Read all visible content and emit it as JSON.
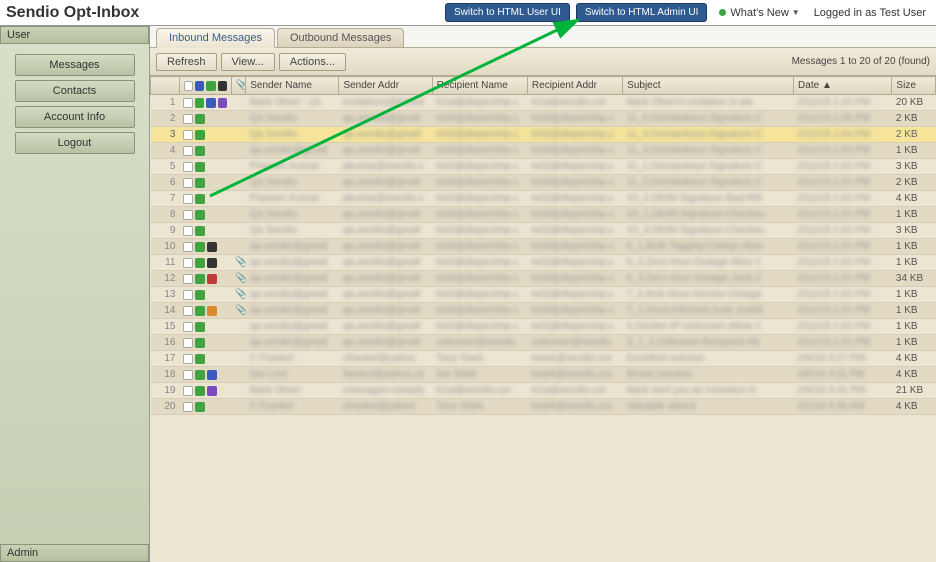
{
  "app": {
    "title": "Sendio Opt-Inbox"
  },
  "header": {
    "switch_user": "Switch to HTML User UI",
    "switch_admin": "Switch to HTML Admin UI",
    "whats_new": "What's New",
    "logged_in": "Logged in as Test User"
  },
  "sidebar": {
    "user_head": "User",
    "admin_head": "Admin",
    "items": [
      "Messages",
      "Contacts",
      "Account Info",
      "Logout"
    ]
  },
  "tabs": {
    "inbound": "Inbound Messages",
    "outbound": "Outbound Messages"
  },
  "toolbar": {
    "refresh": "Refresh",
    "view": "View...",
    "actions": "Actions...",
    "count": "Messages 1 to 20 of 20 (found)"
  },
  "columns": {
    "sender_name": "Sender Name",
    "sender_addr": "Sender Addr",
    "recipient_name": "Recipient Name",
    "recipient_addr": "Recipient Addr",
    "subject": "Subject",
    "date": "Date ▲",
    "size": "Size"
  },
  "rows": [
    {
      "n": 1,
      "flags": [
        "white",
        "green",
        "blue",
        "purple"
      ],
      "att": false,
      "sn": "Mark Olsen - ch.",
      "sa": "invitations@linked",
      "rn": "ts1a@dispership.c",
      "ra": "ts1a@sendio.cor",
      "subj": "Mark Olsen's invitation is aw",
      "date": "2/11/19 1:10 PM",
      "size": "20 KB",
      "sel": false
    },
    {
      "n": 2,
      "flags": [
        "white",
        "green"
      ],
      "att": false,
      "sn": "Qa Sendio",
      "sa": "qa.sendio@gmail",
      "rn": "ts03@dispership.c",
      "ra": "ts03@dispership.c",
      "subj": "11_5.Domainkeys-Signature-C",
      "date": "2/11/19 1:05 PM",
      "size": "2 KB",
      "sel": false
    },
    {
      "n": 3,
      "flags": [
        "white",
        "green"
      ],
      "att": false,
      "sn": "Qa Sendio",
      "sa": "qa.sendio@gmail",
      "rn": "ts03@dispership.c",
      "ra": "ts03@dispership.c",
      "subj": "11_4.Domainkeys-Signature-C",
      "date": "2/11/19 1:04 PM",
      "size": "2 KB",
      "sel": true
    },
    {
      "n": 4,
      "flags": [
        "white",
        "green"
      ],
      "att": false,
      "sn": "qa.sendio@gmail.",
      "sa": "qa.sendio@gmail",
      "rn": "ts03@dispership.c",
      "ra": "ts03@dispership.c",
      "subj": "11_3.Domainkeys-Signature-C",
      "date": "2/11/19 1:03 PM",
      "size": "1 KB",
      "sel": false
    },
    {
      "n": 5,
      "flags": [
        "white",
        "green"
      ],
      "att": false,
      "sn": "Praveen Kumar",
      "sa": "pkumar@sendio.c",
      "rn": "ts03@dispership.c",
      "ra": "ts03@dispership.c",
      "subj": "11_1.Domainkeys-Signature-C",
      "date": "2/11/19 1:01 PM",
      "size": "3 KB",
      "sel": false
    },
    {
      "n": 6,
      "flags": [
        "white",
        "green"
      ],
      "att": false,
      "sn": "Qa Sendio",
      "sa": "qa.sendio@gmail",
      "rn": "ts03@dispership.c",
      "ra": "ts03@dispership.c",
      "subj": "11_2.Domainkeys-Signature-C",
      "date": "2/11/19 1:01 PM",
      "size": "2 KB",
      "sel": false
    },
    {
      "n": 7,
      "flags": [
        "white",
        "green"
      ],
      "att": false,
      "sn": "Praveen Kumar",
      "sa": "pkumar@sendio.c",
      "rn": "ts03@dispership.c",
      "ra": "ts03@dispership.c",
      "subj": "10_2.DKIM-Signature-Bad-MS",
      "date": "2/11/19 1:01 PM",
      "size": "4 KB",
      "sel": false
    },
    {
      "n": 8,
      "flags": [
        "white",
        "green"
      ],
      "att": false,
      "sn": "Qa Sendio",
      "sa": "qa.sendio@gmail",
      "rn": "ts03@dispership.c",
      "ra": "ts03@dispership.c",
      "subj": "10_1.DKIM-Signature-Checksu",
      "date": "2/11/19 1:01 PM",
      "size": "1 KB",
      "sel": false
    },
    {
      "n": 9,
      "flags": [
        "white",
        "green"
      ],
      "att": false,
      "sn": "Qa Sendio",
      "sa": "qa.sendio@gmail",
      "rn": "ts03@dispership.c",
      "ra": "ts03@dispership.c",
      "subj": "10_3.DKIM-Signature-Checksu",
      "date": "2/11/19 1:01 PM",
      "size": "3 KB",
      "sel": false
    },
    {
      "n": 10,
      "flags": [
        "white",
        "green",
        "dark"
      ],
      "att": false,
      "sn": "qa.sendio@gmail.",
      "sa": "qa.sendio@gmail",
      "rn": "ts03@dispership.c",
      "ra": "ts03@dispership.c",
      "subj": "6_1.Bulk-Tagging-Catego-Abor",
      "date": "2/11/19 1:01 PM",
      "size": "1 KB",
      "sel": false
    },
    {
      "n": 11,
      "flags": [
        "white",
        "green",
        "dark"
      ],
      "att": true,
      "sn": "qa.sendio@gmail.",
      "sa": "qa.sendio@gmail",
      "rn": "ts03@dispership.c",
      "ra": "ts03@dispership.c",
      "subj": "6_4.Zero-Hour-Outage-Abor-1",
      "date": "2/11/19 1:01 PM",
      "size": "1 KB",
      "sel": false
    },
    {
      "n": 12,
      "flags": [
        "white",
        "green",
        "red"
      ],
      "att": true,
      "sn": "qa.sendio@gmail.",
      "sa": "qa.sendio@gmail",
      "rn": "ts03@dispership.c",
      "ra": "ts03@dispership.c",
      "subj": "6_3.Zero-Hour-Outage-Junk-2",
      "date": "2/11/19 1:01 PM",
      "size": "34 KB",
      "sel": false
    },
    {
      "n": 13,
      "flags": [
        "white",
        "green"
      ],
      "att": true,
      "sn": "qa.sendio@gmail.",
      "sa": "qa.sendio@gmail",
      "rn": "ts03@dispership.c",
      "ra": "ts03@dispership.c",
      "subj": "7_2.Anti-Virus-Service-Outage",
      "date": "2/11/19 1:01 PM",
      "size": "1 KB",
      "sel": false
    },
    {
      "n": 14,
      "flags": [
        "white",
        "green",
        "orange"
      ],
      "att": true,
      "sn": "qa.sendio@gmail.",
      "sa": "qa.sendio@gmail",
      "rn": "ts03@dispership.c",
      "ra": "ts03@dispership.c",
      "subj": "7_1.Virus-Infected-Junk-JunkB",
      "date": "2/11/19 1:01 PM",
      "size": "1 KB",
      "sel": false
    },
    {
      "n": 15,
      "flags": [
        "white",
        "green"
      ],
      "att": false,
      "sn": "qa.sendio@gmail.",
      "sa": "qa.sendio@gmail",
      "rn": "ts03@dispership.c",
      "ra": "ts03@dispership.c",
      "subj": "4.Sender-IP-Unknown-Allow-1",
      "date": "2/11/19 1:01 PM",
      "size": "1 KB",
      "sel": false,
      "light": true
    },
    {
      "n": 16,
      "flags": [
        "white",
        "green"
      ],
      "att": false,
      "sn": "qa.sendio@gmail.",
      "sa": "qa.sendio@gmail",
      "rn": "unknown@sendio",
      "ra": "unknown@sendio",
      "subj": "3_1_2.Unknown-Recipient-Ab",
      "date": "2/11/19 1:01 PM",
      "size": "1 KB",
      "sel": false
    },
    {
      "n": 17,
      "flags": [
        "white",
        "green"
      ],
      "att": false,
      "sn": "C Frankel",
      "sa": "cfrankel@yahoo",
      "rn": "Tony Stark",
      "ra": "tstark@sendio.cor",
      "subj": "Excellent solution",
      "date": "2/6/19 4:27 PM",
      "size": "4 KB",
      "sel": false
    },
    {
      "n": 18,
      "flags": [
        "white",
        "green",
        "blue"
      ],
      "att": false,
      "sn": "Ilan Levi",
      "sa": "ilanlevi@yahoo.co",
      "rn": "Sal Stark",
      "ra": "tstark@sendio.cor",
      "subj": "Brown solution",
      "date": "2/6/19 4:11 PM",
      "size": "4 KB",
      "sel": false
    },
    {
      "n": 19,
      "flags": [
        "white",
        "green",
        "purple"
      ],
      "att": false,
      "sn": "Mark Olsen",
      "sa": "messages-noreply",
      "rn": "ts1a@sendio.cor",
      "ra": "ts1a@sendio.cor",
      "subj": "Mark sent you an invitation in",
      "date": "2/6/19 4:41 PM",
      "size": "21 KB",
      "sel": false
    },
    {
      "n": 20,
      "flags": [
        "white",
        "green"
      ],
      "att": false,
      "sn": "C Frankel",
      "sa": "cfrankel@yahoo",
      "rn": "Tony Stark",
      "ra": "tstark@sendio.cor",
      "subj": "Valuable advice",
      "date": "2/1/19 4:30 AM",
      "size": "4 KB",
      "sel": false
    }
  ]
}
